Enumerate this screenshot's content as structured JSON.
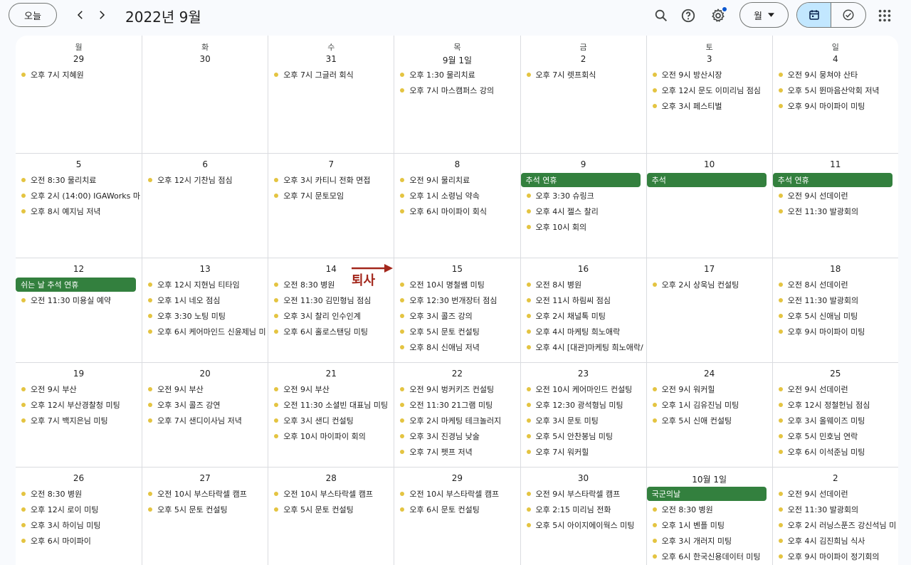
{
  "topbar": {
    "today_label": "오늘",
    "title": "2022년 9월",
    "view_label": "월",
    "icons": [
      "search-icon",
      "help-icon",
      "settings-icon",
      "calendar-icon",
      "task-check-icon",
      "apps-grid-icon"
    ]
  },
  "colors": {
    "event_dot": "#e4c441",
    "allday_bg": "#33803e",
    "annotation": "#a3271c",
    "active_segment": "#c2e7ff"
  },
  "calendar": {
    "weekdays": [
      "월",
      "화",
      "수",
      "목",
      "금",
      "토",
      "일"
    ],
    "weeks": [
      {
        "days": [
          {
            "date": "29",
            "allday": [],
            "events": [
              "오후 7시 지혜원"
            ]
          },
          {
            "date": "30",
            "allday": [],
            "events": []
          },
          {
            "date": "31",
            "allday": [],
            "events": [
              "오후 7시 그글러 회식"
            ]
          },
          {
            "date": "9월 1일",
            "allday": [],
            "events": [
              "오후 1:30 물리치료",
              "오후 7시 마스캠퍼스 강의"
            ]
          },
          {
            "date": "2",
            "allday": [],
            "events": [
              "오후 7시 렛프회식"
            ]
          },
          {
            "date": "3",
            "allday": [],
            "events": [
              "오전 9시 방산시장",
              "오후 12시 문도 이미리님 점심",
              "오후 3시 페스티벌"
            ]
          },
          {
            "date": "4",
            "allday": [],
            "events": [
              "오전 9시 뭉쳐야 산타",
              "오후 5시 뛴마음산악회 저녁",
              "오후 9시 마이파이 미팅"
            ]
          }
        ]
      },
      {
        "days": [
          {
            "date": "5",
            "allday": [],
            "events": [
              "오전 8:30 물리치료",
              "오후 2시 (14:00) IGAWorks 마",
              "오후 8시 예지님 저녁"
            ]
          },
          {
            "date": "6",
            "allday": [],
            "events": [
              "오후 12시 기찬님 점심"
            ]
          },
          {
            "date": "7",
            "allday": [],
            "events": [
              "오후 3시 카티니 전화 면접",
              "오후 7시 문토모임"
            ]
          },
          {
            "date": "8",
            "allday": [],
            "events": [
              "오전 9시 물리치료",
              "오후 1시 소령님 약속",
              "오후 6시 마이파이 회식"
            ]
          },
          {
            "date": "9",
            "allday": [
              "추석 연휴"
            ],
            "events": [
              "오후 3:30 슈링크",
              "오후 4시 젤스 찰리",
              "오후 10시 회의"
            ]
          },
          {
            "date": "10",
            "allday": [
              "추석"
            ],
            "events": []
          },
          {
            "date": "11",
            "allday": [
              "추석 연휴"
            ],
            "events": [
              "오전 9시 선데이런",
              "오전 11:30 발광회의"
            ]
          }
        ]
      },
      {
        "days": [
          {
            "date": "12",
            "allday": [
              "쉬는 날 추석 연휴"
            ],
            "events": [
              "오전 11:30 미용실 예약"
            ]
          },
          {
            "date": "13",
            "allday": [],
            "events": [
              "오후 12시 지현님 티타임",
              "오후 1시 네오 점심",
              "오후 3:30 노팅 미팅",
              "오후 6시 케어마인드 신윤제님 미"
            ]
          },
          {
            "date": "14",
            "allday": [],
            "events": [
              "오전 8:30 병원",
              "오전 11:30 김민형님 점심",
              "오후 3시 찰리 인수인계",
              "오후 6시 홀로스탠딩 미팅"
            ]
          },
          {
            "date": "15",
            "allday": [],
            "events": [
              "오전 10시 명철쌤 미팅",
              "오후 12:30 번개장터 점심",
              "오후 3시 콜즈 강의",
              "오후 5시 문토 컨설팅",
              "오후 8시 신애님 저녁"
            ]
          },
          {
            "date": "16",
            "allday": [],
            "events": [
              "오전 8시 병원",
              "오전 11시 하림씨 점심",
              "오후 2시 채널톡 미팅",
              "오후 4시 마케팅 희노애락",
              "오후 4시 [대관]마케팅 희노애락/"
            ]
          },
          {
            "date": "17",
            "allday": [],
            "events": [
              "오후 2시 상욱님 컨설팅"
            ]
          },
          {
            "date": "18",
            "allday": [],
            "events": [
              "오전 8시 선데이런",
              "오전 11:30 발광회의",
              "오후 5시 신애님 미팅",
              "오후 9시 마이파이 미팅"
            ]
          }
        ]
      },
      {
        "days": [
          {
            "date": "19",
            "allday": [],
            "events": [
              "오전 9시 부산",
              "오후 12시 부산경찰청 미팅",
              "오후 7시 백지은님 미팅"
            ]
          },
          {
            "date": "20",
            "allday": [],
            "events": [
              "오전 9시 부산",
              "오후 3시 콜즈 강연",
              "오후 7시 샌디이사님 저녁"
            ]
          },
          {
            "date": "21",
            "allday": [],
            "events": [
              "오전 9시 부산",
              "오전 11:30 소셜빈 대표님 미팅",
              "오후 3시 샌디 컨설팅",
              "오후 10시 마이파이 회의"
            ]
          },
          {
            "date": "22",
            "allday": [],
            "events": [
              "오전 9시 벙커키즈 컨설팅",
              "오전 11:30 21그램 미팅",
              "오후 2시 마케팅 테크놀러지",
              "오후 3시 진경님 낮술",
              "오후 7시 펫프 저녁"
            ]
          },
          {
            "date": "23",
            "allday": [],
            "events": [
              "오전 10시 케어마인드 컨설팅",
              "오후 12:30 광석형님 미팅",
              "오후 3시 문토 미팅",
              "오후 5시 안찬봉님 미팅",
              "오후 7시 워커힐"
            ]
          },
          {
            "date": "24",
            "allday": [],
            "events": [
              "오전 9시 워커힐",
              "오후 1시 김유진님 미팅",
              "오후 5시 신애 컨설팅"
            ]
          },
          {
            "date": "25",
            "allday": [],
            "events": [
              "오전 9시 선데이런",
              "오후 12시 정철헌님 점심",
              "오후 3시 올웨이즈 미팅",
              "오후 5시 민호님 연락",
              "오후 6시 이석준님 미팅"
            ]
          }
        ]
      },
      {
        "days": [
          {
            "date": "26",
            "allday": [],
            "events": [
              "오전 8:30 병원",
              "오후 12시 로이 미팅",
              "오후 3시 하이님 미팅",
              "오후 6시 마이파이"
            ]
          },
          {
            "date": "27",
            "allday": [],
            "events": [
              "오전 10시 부스타락셀 캠프",
              "오후 5시 문토 컨설팅"
            ]
          },
          {
            "date": "28",
            "allday": [],
            "events": [
              "오전 10시 부스타락셀 캠프",
              "오후 5시 문토 컨설팅"
            ]
          },
          {
            "date": "29",
            "allday": [],
            "events": [
              "오전 10시 부스타락셀 캠프",
              "오후 6시 문토 컨설팅"
            ]
          },
          {
            "date": "30",
            "allday": [],
            "events": [
              "오전 9시 부스타락셀 캠프",
              "오후 2:15 미리님 전화",
              "오후 5시 아이지에이웍스 미팅"
            ]
          },
          {
            "date": "10월 1일",
            "allday": [
              "국군의날"
            ],
            "events": [
              "오전 8:30 병원",
              "오후 1시 벤플 미팅",
              "오후 3시 개러지 미팅",
              "오후 6시 한국신용데이터 미팅"
            ]
          },
          {
            "date": "2",
            "allday": [],
            "events": [
              "오전 9시 선데이런",
              "오전 11:30 발광회의",
              "오후 2시 러닝스푼즈 강신석님 미",
              "오후 4시 김진희님 식사",
              "오후 9시 마이파이 정기회의"
            ]
          }
        ]
      }
    ]
  },
  "annotation": {
    "text": "퇴사"
  }
}
